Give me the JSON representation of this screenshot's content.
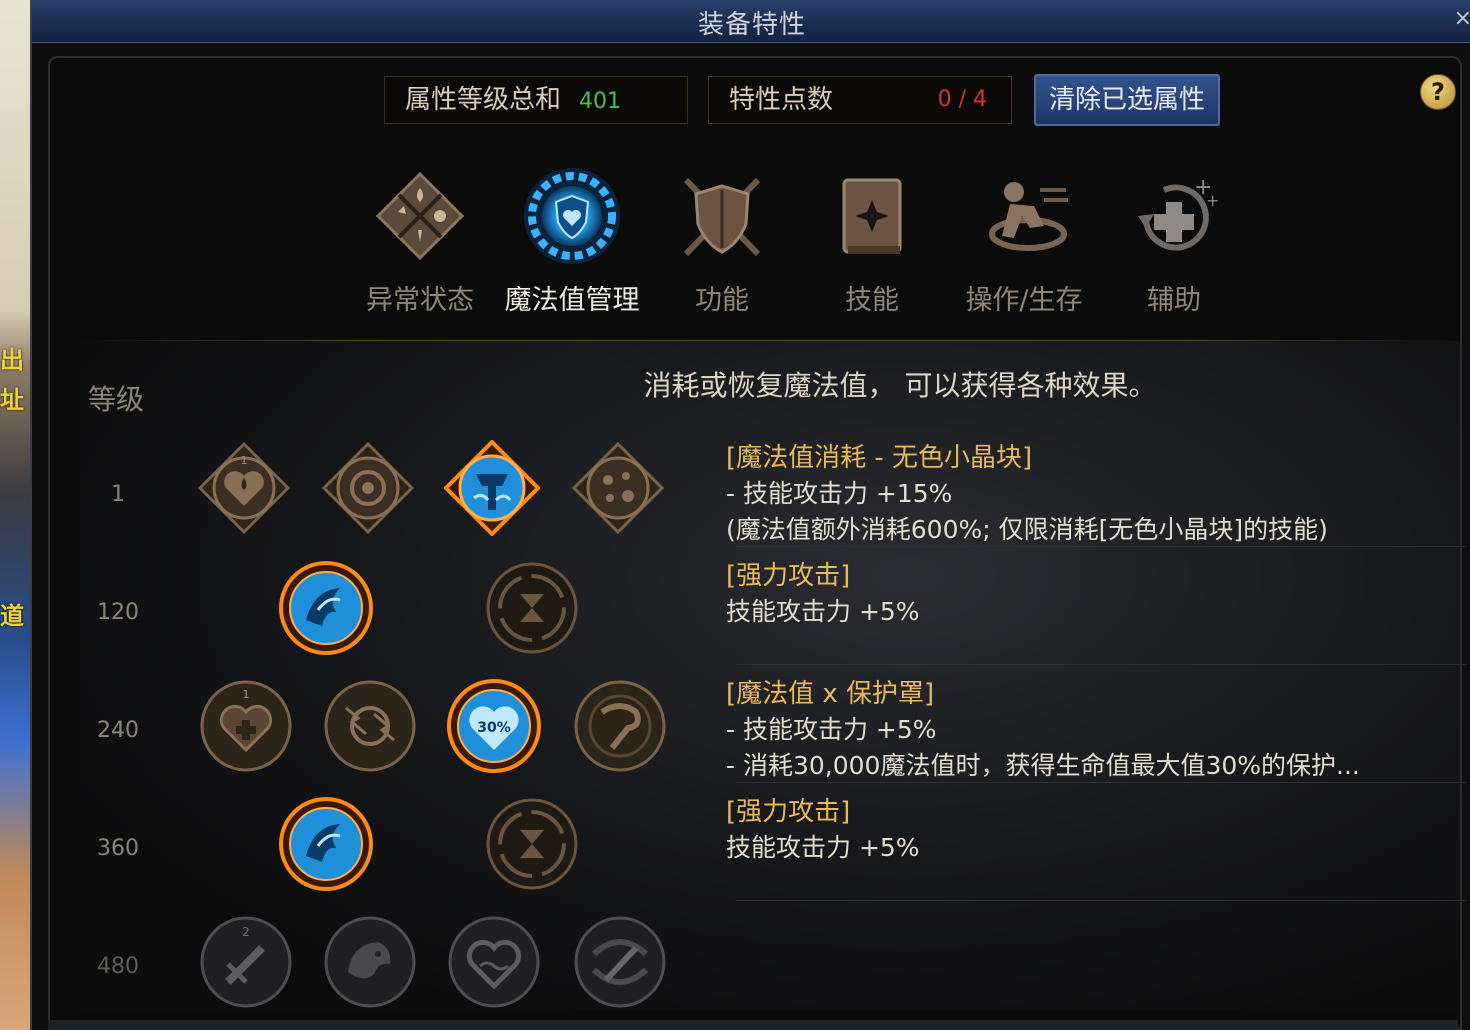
{
  "window": {
    "title": "装备特性",
    "close_label": "×"
  },
  "background_fragments": [
    "出",
    "址",
    "道"
  ],
  "header": {
    "attr_total_label": "属性等级总和",
    "attr_total_value": "401",
    "trait_points_label": "特性点数",
    "trait_points_value": "0 / 4",
    "clear_button": "清除已选属性",
    "help_label": "?"
  },
  "categories": [
    {
      "label": "异常状态",
      "icon": "elements-diamond-icon",
      "active": false
    },
    {
      "label": "魔法值管理",
      "icon": "mana-shield-gear-icon",
      "active": true
    },
    {
      "label": "功能",
      "icon": "crossed-shield-icon",
      "active": false
    },
    {
      "label": "技能",
      "icon": "skill-book-icon",
      "active": false
    },
    {
      "label": "操作/生存",
      "icon": "dash-runner-icon",
      "active": false
    },
    {
      "label": "辅助",
      "icon": "support-cross-icon",
      "active": false
    }
  ],
  "tree": {
    "level_header": "等级",
    "description": "消耗或恢复魔法值， 可以获得各种效果。",
    "levels": [
      "1",
      "120",
      "240",
      "360",
      "480"
    ],
    "rows": [
      {
        "nodes": [
          {
            "icon": "mana-drop-heart-icon",
            "state": "locked-bronze",
            "badge": "1"
          },
          {
            "icon": "mana-orb-icon",
            "state": "locked-bronze",
            "badge": ""
          },
          {
            "icon": "colorless-crystal-icon",
            "state": "selected",
            "badge": ""
          },
          {
            "icon": "scattered-crystals-icon",
            "state": "locked-bronze",
            "badge": ""
          }
        ],
        "info": {
          "name": "[魔法值消耗 - 无色小晶块]",
          "lines": [
            "- 技能攻击力 +15%",
            "(魔法值额外消耗600%; 仅限消耗[无色小晶块]的技能)"
          ]
        }
      },
      {
        "nodes": [
          {
            "icon": "power-strike-icon",
            "state": "selected",
            "badge": ""
          },
          {
            "icon": "hourglass-cycle-icon",
            "state": "locked-bronze",
            "badge": ""
          }
        ],
        "info": {
          "name": "[强力攻击]",
          "lines": [
            "技能攻击力 +5%"
          ]
        }
      },
      {
        "nodes": [
          {
            "icon": "heart-plus-icon",
            "state": "locked-bronze",
            "badge": "1"
          },
          {
            "icon": "lightning-orb-icon",
            "state": "locked-bronze",
            "badge": ""
          },
          {
            "icon": "heart-shield-30-icon",
            "state": "selected",
            "badge": "30%"
          },
          {
            "icon": "swirl-strike-icon",
            "state": "locked-bronze",
            "badge": ""
          }
        ],
        "info": {
          "name": "[魔法值 x 保护罩]",
          "lines": [
            "- 技能攻击力 +5%",
            "- 消耗30,000魔法值时，获得生命值最大值30%的保护..."
          ]
        }
      },
      {
        "nodes": [
          {
            "icon": "power-strike-icon",
            "state": "selected",
            "badge": ""
          },
          {
            "icon": "hourglass-cycle-icon",
            "state": "locked-bronze",
            "badge": ""
          }
        ],
        "info": {
          "name": "[强力攻击]",
          "lines": [
            "技能攻击力 +5%"
          ]
        }
      },
      {
        "nodes": [
          {
            "icon": "sword-upgrade-icon",
            "state": "locked-gray",
            "badge": "2"
          },
          {
            "icon": "dragon-head-icon",
            "state": "locked-gray",
            "badge": ""
          },
          {
            "icon": "heart-wave-icon",
            "state": "locked-gray",
            "badge": ""
          },
          {
            "icon": "blade-swirl-icon",
            "state": "locked-gray",
            "badge": ""
          }
        ],
        "info": {
          "name": "",
          "lines": []
        }
      }
    ]
  },
  "colors": {
    "gold_text": "#e7b95a",
    "green_value": "#48c04a",
    "red_value": "#e0322c",
    "selected_ring": "#ff8a18",
    "selected_fill": "#1e8fd8"
  }
}
